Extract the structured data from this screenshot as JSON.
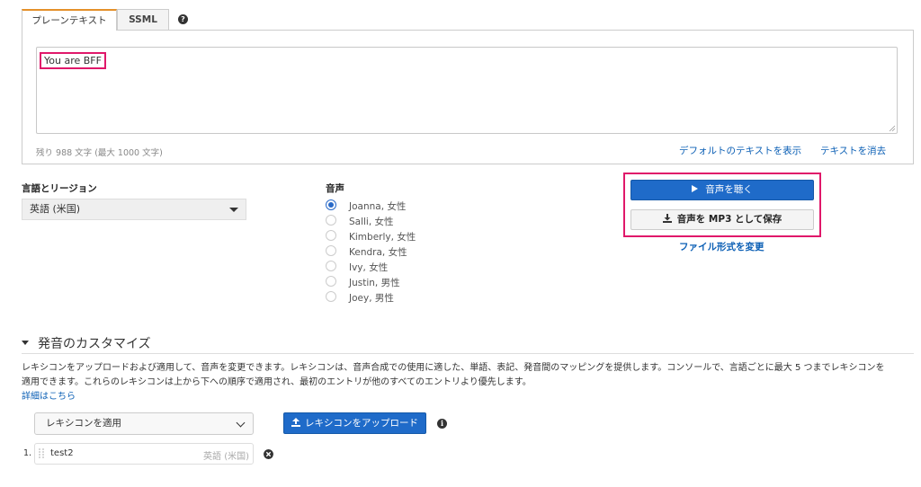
{
  "tabs": [
    {
      "label": "プレーンテキスト",
      "active": true
    },
    {
      "label": "SSML",
      "active": false
    }
  ],
  "help_icon": {
    "glyph": "?",
    "name": "help-icon"
  },
  "textarea": {
    "value": "You are BFF"
  },
  "chars_remaining": "残り 988 文字 (最大 1000 文字)",
  "text_links": {
    "show_default": "デフォルトのテキストを表示",
    "clear": "テキストを消去"
  },
  "language": {
    "label": "言語とリージョン",
    "selected": "英語 (米国)"
  },
  "voice": {
    "label": "音声",
    "options": [
      {
        "label": "Joanna, 女性",
        "checked": true
      },
      {
        "label": "Salli, 女性",
        "checked": false
      },
      {
        "label": "Kimberly, 女性",
        "checked": false
      },
      {
        "label": "Kendra, 女性",
        "checked": false
      },
      {
        "label": "Ivy, 女性",
        "checked": false
      },
      {
        "label": "Justin, 男性",
        "checked": false
      },
      {
        "label": "Joey, 男性",
        "checked": false
      }
    ]
  },
  "actions": {
    "listen": "音声を聴く",
    "save_mp3": "音声を MP3 として保存",
    "change_format": "ファイル形式を変更"
  },
  "customize": {
    "title": "発音のカスタマイズ",
    "description_line1": "レキシコンをアップロードおよび適用して、音声を変更できます。レキシコンは、音声合成での使用に適した、単語、表記、発音間のマッピングを提供します。コンソールで、言語ごとに最大 5 つまでレキシコンを",
    "description_line2": "適用できます。これらのレキシコンは上から下への順序で適用され、最初のエントリが他のすべてのエントリより優先します。",
    "details_link": "詳細はこちら",
    "apply_select": "レキシコンを適用",
    "upload_button": "レキシコンをアップロード",
    "info_glyph": "i",
    "lexicons": [
      {
        "index": "1.",
        "name": "test2",
        "language": "英語 (米国)"
      }
    ]
  },
  "colors": {
    "accent_blue": "#1f6bc9",
    "link_blue": "#0b5fb5",
    "highlight": "#e0186a",
    "tab_accent": "#e4902a"
  }
}
